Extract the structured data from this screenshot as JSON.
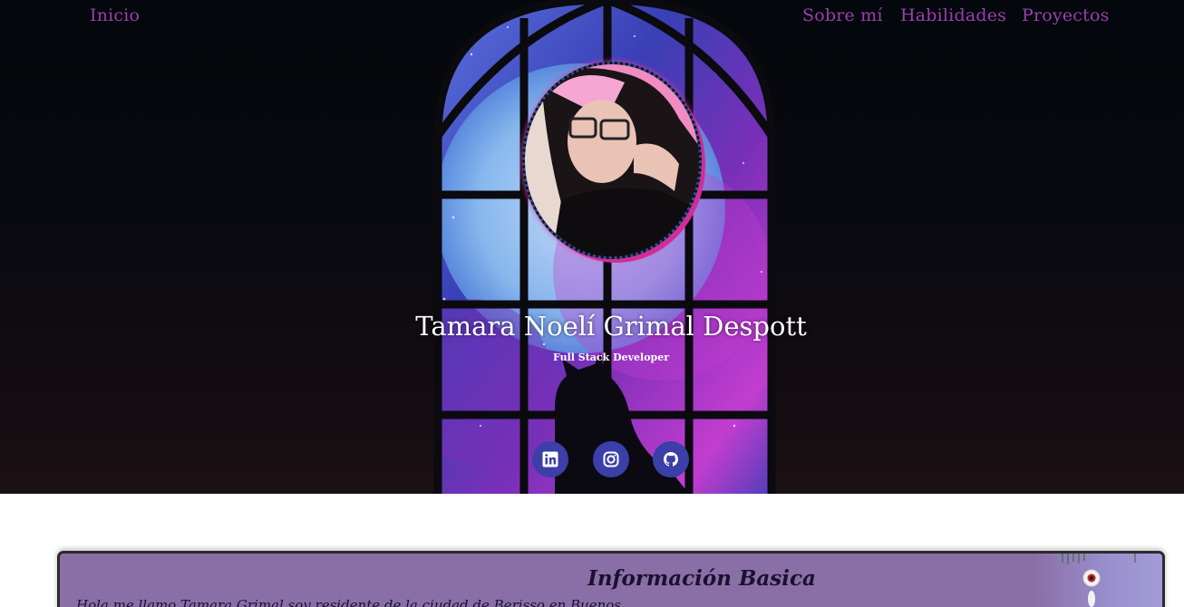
{
  "nav": {
    "inicio": "Inicio",
    "sobre_mi": "Sobre mí",
    "habilidades": "Habilidades",
    "proyectos": "Proyectos",
    "link_color": "#9b3fb0"
  },
  "hero": {
    "name": "Tamara Noelí Grimal Despott",
    "role": "Full Stack Developer"
  },
  "social": [
    {
      "name": "linkedin",
      "icon": "linkedin-icon"
    },
    {
      "name": "instagram",
      "icon": "instagram-icon"
    },
    {
      "name": "github",
      "icon": "github-icon"
    }
  ],
  "colors": {
    "social_bg": "#3b3fa7",
    "avatar_ring": "#d12d97",
    "card_bg": "#8a6fa6"
  },
  "info": {
    "title": "Información Basica",
    "text": "Hola me llamo Tamara Grimal soy residente de la ciudad de Berisso en Buenos"
  }
}
